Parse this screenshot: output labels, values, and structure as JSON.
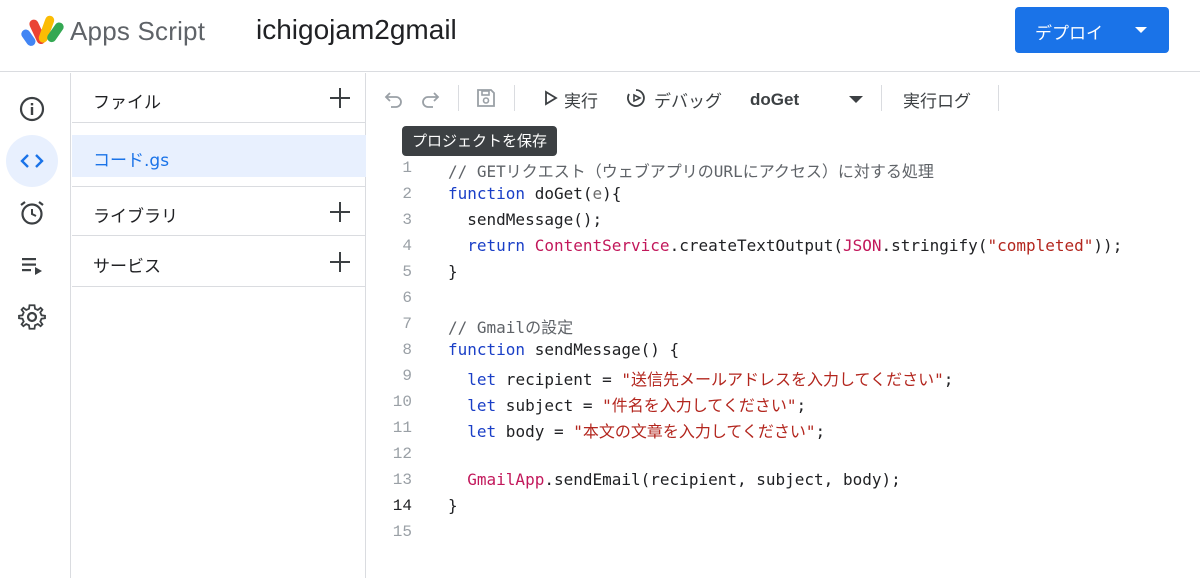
{
  "header": {
    "brand": "Apps Script",
    "project_title": "ichigojam2gmail",
    "deploy_label": "デプロイ"
  },
  "rail": {
    "items": [
      {
        "name": "overview",
        "icon": "info-icon"
      },
      {
        "name": "editor",
        "icon": "code-icon",
        "active": true
      },
      {
        "name": "triggers",
        "icon": "alarm-clock-icon"
      },
      {
        "name": "executions",
        "icon": "list-play-icon"
      },
      {
        "name": "settings",
        "icon": "gear-icon"
      }
    ]
  },
  "files_panel": {
    "files_label": "ファイル",
    "active_file": "コード.gs",
    "libraries_label": "ライブラリ",
    "services_label": "サービス"
  },
  "toolbar": {
    "run_label": "実行",
    "debug_label": "デバッグ",
    "function_name": "doGet",
    "log_label": "実行ログ",
    "save_tooltip": "プロジェクトを保存"
  },
  "editor": {
    "current_line": 14,
    "line_numbers": [
      "1",
      "2",
      "3",
      "4",
      "5",
      "6",
      "7",
      "8",
      "9",
      "10",
      "11",
      "12",
      "13",
      "14",
      "15"
    ],
    "lines": [
      [
        {
          "t": "// GETリクエスト（ウェブアプリのURLにアクセス）に対する処理",
          "c": "cm"
        }
      ],
      [
        {
          "t": "function",
          "c": "kw"
        },
        {
          "t": " doGet("
        },
        {
          "t": "e",
          "c": "par"
        },
        {
          "t": "){"
        }
      ],
      [
        {
          "t": "  sendMessage();"
        }
      ],
      [
        {
          "t": "  "
        },
        {
          "t": "return",
          "c": "kw"
        },
        {
          "t": " "
        },
        {
          "t": "ContentService",
          "c": "cls"
        },
        {
          "t": ".createTextOutput("
        },
        {
          "t": "JSON",
          "c": "cls"
        },
        {
          "t": ".stringify("
        },
        {
          "t": "\"completed\"",
          "c": "str"
        },
        {
          "t": "));"
        }
      ],
      [
        {
          "t": "}"
        }
      ],
      [
        {
          "t": ""
        }
      ],
      [
        {
          "t": "// Gmailの設定",
          "c": "cm"
        }
      ],
      [
        {
          "t": "function",
          "c": "kw"
        },
        {
          "t": " sendMessage() {"
        }
      ],
      [
        {
          "t": "  "
        },
        {
          "t": "let",
          "c": "kw"
        },
        {
          "t": " recipient = "
        },
        {
          "t": "\"送信先メールアドレスを入力してください\"",
          "c": "str"
        },
        {
          "t": ";"
        }
      ],
      [
        {
          "t": "  "
        },
        {
          "t": "let",
          "c": "kw"
        },
        {
          "t": " subject = "
        },
        {
          "t": "\"件名を入力してください\"",
          "c": "str"
        },
        {
          "t": ";"
        }
      ],
      [
        {
          "t": "  "
        },
        {
          "t": "let",
          "c": "kw"
        },
        {
          "t": " body = "
        },
        {
          "t": "\"本文の文章を入力してください\"",
          "c": "str"
        },
        {
          "t": ";"
        }
      ],
      [
        {
          "t": ""
        }
      ],
      [
        {
          "t": "  "
        },
        {
          "t": "GmailApp",
          "c": "cls"
        },
        {
          "t": ".sendEmail(recipient, subject, body);"
        }
      ],
      [
        {
          "t": "}"
        }
      ],
      [
        {
          "t": ""
        }
      ]
    ]
  },
  "colors": {
    "accent": "#1a73e8",
    "keyword": "#1a3fc7",
    "string": "#b3261e",
    "class": "#c2185b",
    "comment": "#5f6368"
  }
}
